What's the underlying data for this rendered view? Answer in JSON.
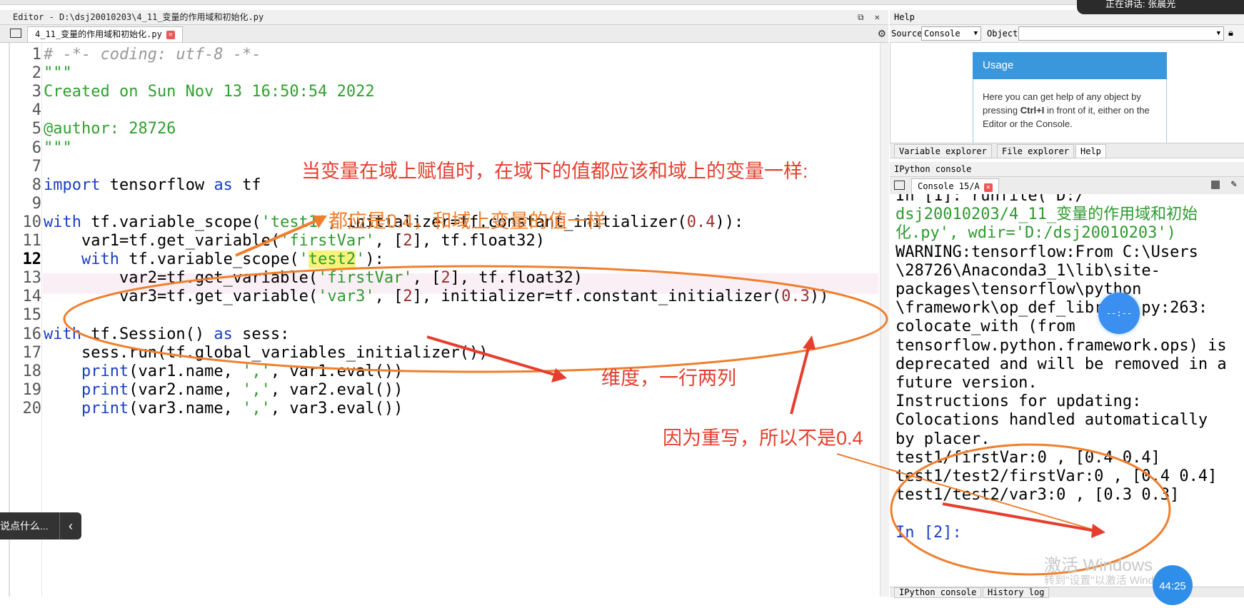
{
  "editor": {
    "title": "Editor - D:\\dsj20010203\\4_11_变量的作用域和初始化.py",
    "window_buttons": "⧉ ✕",
    "tab_label": "4_11_变量的作用域和初始化.py",
    "tab_close": "✕",
    "current_line": 12,
    "lines": [
      {
        "num": "1",
        "html": "<span class=\"c-com\"># -*- coding: utf-8 -*-</span>"
      },
      {
        "num": "2",
        "html": "<span class=\"c-doc\">\"\"\"</span>"
      },
      {
        "num": "3",
        "html": "<span class=\"c-doc\">Created on Sun Nov 13 16:50:54 2022</span>"
      },
      {
        "num": "4",
        "html": ""
      },
      {
        "num": "5",
        "html": "<span class=\"c-doc\">@author: 28726</span>"
      },
      {
        "num": "6",
        "html": "<span class=\"c-doc\">\"\"\"</span>"
      },
      {
        "num": "7",
        "html": ""
      },
      {
        "num": "8",
        "html": "<span class=\"c-kw\">import</span> tensorflow <span class=\"c-kw\">as</span> tf"
      },
      {
        "num": "9",
        "html": ""
      },
      {
        "num": "10",
        "html": "<span class=\"c-kw\">with</span> tf.variable_scope(<span class=\"c-str\">'test1'</span>, initializer=tf.constant_initializer(<span class=\"c-num\">0.4</span>)):"
      },
      {
        "num": "11",
        "html": "    var1=tf.get_variable(<span class=\"c-str\">'firstVar'</span>, [<span class=\"c-num\">2</span>], tf.float32)"
      },
      {
        "num": "12",
        "html": "    <span class=\"c-kw\">with</span> tf.variable_scope(<span class=\"c-str\">'<span class=\"hl\">test2</span>'</span>):"
      },
      {
        "num": "13",
        "html": "        var2=tf.get_variable(<span class=\"c-str\">'firstVar'</span>, [<span class=\"c-num\">2</span>], tf.float32)"
      },
      {
        "num": "14",
        "html": "        var3=tf.get_variable(<span class=\"c-str\">'var3'</span>, [<span class=\"c-num\">2</span>], initializer=tf.constant_initializer(<span class=\"c-num\">0.3</span>))"
      },
      {
        "num": "15",
        "html": ""
      },
      {
        "num": "16",
        "html": "<span class=\"c-kw\">with</span> tf.Session() <span class=\"c-kw\">as</span> sess:"
      },
      {
        "num": "17",
        "html": "    sess.run(tf.global_variables_initializer())"
      },
      {
        "num": "18",
        "html": "    <span class=\"c-kw\">print</span>(var1.name, <span class=\"c-str\">','</span>, var1.eval())"
      },
      {
        "num": "19",
        "html": "    <span class=\"c-kw\">print</span>(var2.name, <span class=\"c-str\">','</span>, var2.eval())"
      },
      {
        "num": "20",
        "html": "    <span class=\"c-kw\">print</span>(var3.name, <span class=\"c-str\">','</span>, var3.eval())"
      }
    ]
  },
  "help": {
    "title": "Help",
    "source_label": "Source",
    "source_value": "Console",
    "object_label": "Object",
    "usage_title": "Usage",
    "usage_text_1": "Here you can get help of any object by pressing ",
    "usage_key": "Ctrl+I",
    "usage_text_2": " in front of it, either on the Editor or the Console.",
    "tabs": [
      "Variable explorer",
      "File explorer",
      "Help"
    ]
  },
  "console": {
    "title": "IPython console",
    "tab_label": "Console 15/A",
    "lines": [
      {
        "cls": "",
        "text": "In [1]: runfile('D:/"
      },
      {
        "cls": "con-green",
        "text": "dsj20010203/4_11_变量的作用域和初始"
      },
      {
        "cls": "con-green",
        "text": "化.py', wdir='D:/dsj20010203')"
      },
      {
        "cls": "",
        "text": "WARNING:tensorflow:From C:\\Users"
      },
      {
        "cls": "",
        "text": "\\28726\\Anaconda3_1\\lib\\site-"
      },
      {
        "cls": "",
        "text": "packages\\tensorflow\\python"
      },
      {
        "cls": "",
        "text": "\\framework\\op_def_library.py:263:"
      },
      {
        "cls": "",
        "text": "colocate_with (from"
      },
      {
        "cls": "",
        "text": "tensorflow.python.framework.ops) is"
      },
      {
        "cls": "",
        "text": "deprecated and will be removed in a"
      },
      {
        "cls": "",
        "text": "future version."
      },
      {
        "cls": "",
        "text": "Instructions for updating:"
      },
      {
        "cls": "",
        "text": "Colocations handled automatically"
      },
      {
        "cls": "",
        "text": "by placer."
      },
      {
        "cls": "",
        "text": "test1/firstVar:0 , [0.4 0.4]"
      },
      {
        "cls": "",
        "text": "test1/test2/firstVar:0 , [0.4 0.4]"
      },
      {
        "cls": "",
        "text": "test1/test2/var3:0 , [0.3 0.3]"
      },
      {
        "cls": "",
        "text": ""
      },
      {
        "cls": "con-blue",
        "text": "In [2]:"
      }
    ],
    "bottom_tabs": [
      "IPython console",
      "History log"
    ]
  },
  "overlay": {
    "notification": "正在讲话: 张晨光",
    "chat_placeholder": "说点什么...",
    "chat_toggle": "‹",
    "watermark": "激活 Windows",
    "watermark_sub": "转到\"设置\"以激活 Windows。",
    "timer": "44:25",
    "float_ball": "--:--"
  },
  "annotations": {
    "top_note": "当变量在域上赋值时，在域下的值都应该和域上的变量一样:",
    "should_be_04": "都应是0.4，和域上变量的值一样",
    "dimension": "维度，一行两列",
    "overridden": "因为重写，所以不是0.4"
  },
  "colors": {
    "red_annotation": "#e53e2e",
    "orange_annotation": "#ef7f2d",
    "usage_header": "#3a97dc"
  }
}
